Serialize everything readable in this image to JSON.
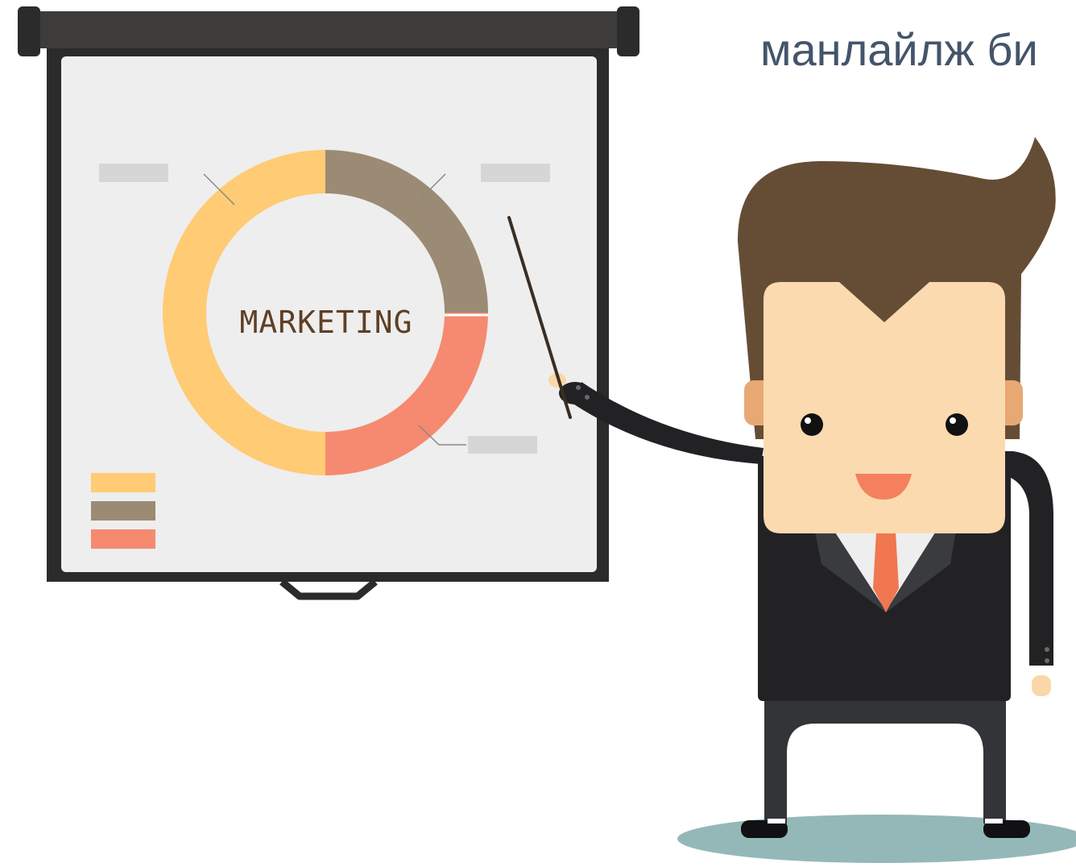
{
  "headline": "манлайлж би",
  "screen": {
    "chart_word": "MARKETING"
  },
  "colors": {
    "headline_text": "#44546a",
    "segment_yellow": "#ffcb74",
    "segment_taupe": "#9b8b75",
    "segment_coral": "#f58a70",
    "chart_word": "#5e3f25",
    "hair": "#654d35",
    "skin": "#fbdab0",
    "suit": "#222225",
    "tie": "#f07750",
    "floor_shadow": "#94b8b8"
  },
  "chart_data": {
    "type": "pie",
    "values": [
      50,
      25,
      25
    ],
    "colors": [
      "#ffcb74",
      "#9b8b75",
      "#f58a70"
    ],
    "title": "MARKETING"
  }
}
